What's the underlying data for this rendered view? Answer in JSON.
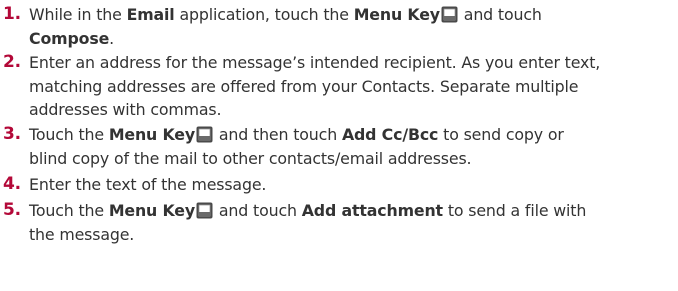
{
  "steps": [
    {
      "number": "1.",
      "lines": [
        {
          "parts": [
            {
              "t": "While in the ",
              "b": false
            },
            {
              "t": "Email",
              "b": true
            },
            {
              "t": " application, touch the ",
              "b": false
            },
            {
              "t": "Menu Key",
              "b": true
            },
            {
              "icon": "menu-key-icon"
            },
            {
              "t": " and touch",
              "b": false
            }
          ]
        },
        {
          "parts": [
            {
              "t": "Compose",
              "b": true
            },
            {
              "t": ".",
              "b": false
            }
          ]
        }
      ]
    },
    {
      "number": "2.",
      "lines": [
        {
          "parts": [
            {
              "t": "Enter an address for the message’s intended recipient. As you enter text,",
              "b": false
            }
          ]
        },
        {
          "parts": [
            {
              "t": "matching addresses are offered from your Contacts. Separate multiple",
              "b": false
            }
          ]
        },
        {
          "parts": [
            {
              "t": "addresses with commas.",
              "b": false
            }
          ]
        }
      ]
    },
    {
      "number": "3.",
      "lines": [
        {
          "parts": [
            {
              "t": "Touch the ",
              "b": false
            },
            {
              "t": "Menu Key",
              "b": true
            },
            {
              "icon": "menu-key-icon"
            },
            {
              "t": " and then touch ",
              "b": false
            },
            {
              "t": "Add Cc/Bcc",
              "b": true
            },
            {
              "t": " to send copy or",
              "b": false
            }
          ]
        },
        {
          "parts": [
            {
              "t": "blind copy of the mail to other contacts/email addresses.",
              "b": false
            }
          ]
        }
      ]
    },
    {
      "number": "4.",
      "lines": [
        {
          "parts": [
            {
              "t": "Enter the text of the message.",
              "b": false
            }
          ]
        }
      ]
    },
    {
      "number": "5.",
      "lines": [
        {
          "parts": [
            {
              "t": "Touch the ",
              "b": false
            },
            {
              "t": "Menu Key",
              "b": true
            },
            {
              "icon": "menu-key-icon"
            },
            {
              "t": " and touch ",
              "b": false
            },
            {
              "t": "Add attachment",
              "b": true
            },
            {
              "t": " to send a file with",
              "b": false
            }
          ]
        },
        {
          "parts": [
            {
              "t": "the message.",
              "b": false
            }
          ]
        }
      ]
    }
  ],
  "colors": {
    "step_number": "#b30838",
    "text": "#333333",
    "menu_key_fill": "#4a4a4a",
    "menu_key_frame": "#9a9a9a"
  }
}
